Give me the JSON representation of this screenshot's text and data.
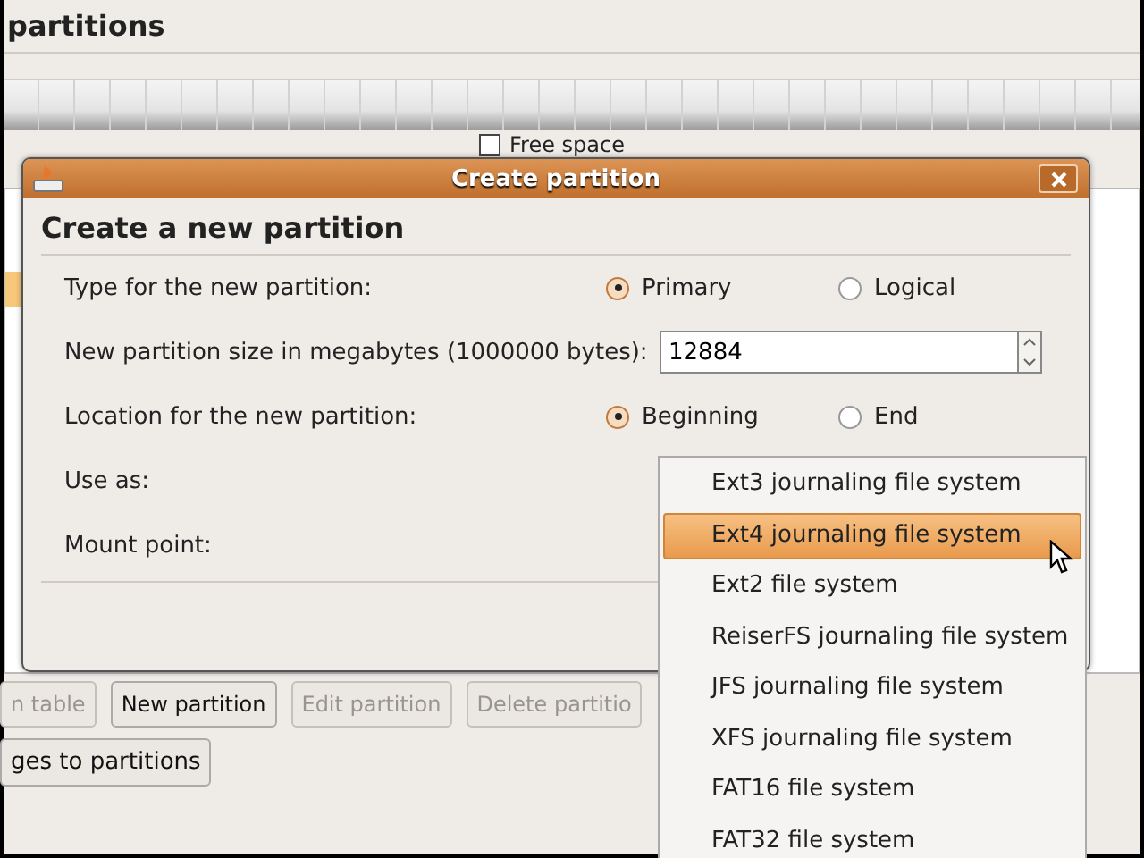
{
  "main_window": {
    "title": "partitions",
    "legend": {
      "label": "Free space"
    },
    "buttons": [
      {
        "label": "n table",
        "disabled": true
      },
      {
        "label": "New partition",
        "disabled": false
      },
      {
        "label": "Edit partition",
        "disabled": true
      },
      {
        "label": "Delete partitio",
        "disabled": true
      }
    ],
    "apply_button": "ges to partitions"
  },
  "dialog": {
    "title": "Create partition",
    "heading": "Create a new partition",
    "rows": [
      {
        "kind": "radio",
        "label": "Type for the new partition:",
        "options": [
          {
            "label": "Primary",
            "selected": true
          },
          {
            "label": "Logical",
            "selected": false
          }
        ]
      },
      {
        "kind": "spin",
        "label": "New partition size in megabytes (1000000 bytes):",
        "value": "12884"
      },
      {
        "kind": "radio",
        "label": "Location for the new partition:",
        "options": [
          {
            "label": "Beginning",
            "selected": true
          },
          {
            "label": "End",
            "selected": false
          }
        ]
      },
      {
        "kind": "plain",
        "label": "Use as:"
      },
      {
        "kind": "plain",
        "label": "Mount point:"
      }
    ]
  },
  "menu": {
    "items": [
      {
        "label": "Ext3 journaling file system",
        "selected": false
      },
      {
        "label": "Ext4 journaling file system",
        "selected": true
      },
      {
        "label": "Ext2 file system",
        "selected": false
      },
      {
        "label": "ReiserFS journaling file system",
        "selected": false
      },
      {
        "label": "JFS journaling file system",
        "selected": false
      },
      {
        "label": "XFS journaling file system",
        "selected": false
      },
      {
        "label": "FAT16 file system",
        "selected": false
      },
      {
        "label": "FAT32 file system",
        "selected": false
      }
    ]
  }
}
